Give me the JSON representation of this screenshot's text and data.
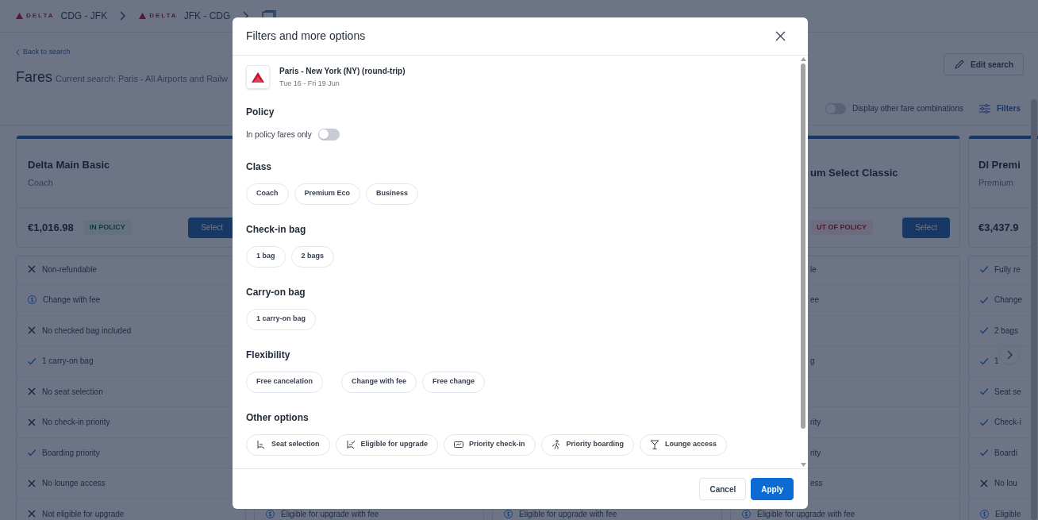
{
  "breadcrumbs": [
    {
      "kind": "flight",
      "airline": "DELTA",
      "route": "CDG - JFK"
    },
    {
      "kind": "flight",
      "airline": "DELTA",
      "route": "JFK - CDG"
    },
    {
      "kind": "page"
    }
  ],
  "back_link": "Back to search",
  "page_title": "Fares",
  "current_search": "Current search: Paris - All Airports and Railw",
  "edit_search_button": "Edit search",
  "fare_combinations_toggle": {
    "label": "Display other fare combinations",
    "on": false
  },
  "filters_link": "Filters",
  "fare_cards": [
    {
      "title": "Delta Main Basic",
      "cabin": "Coach",
      "price": "€1,016.98",
      "policy": {
        "kind": "in",
        "label": "IN POLICY"
      },
      "select_button": "Select",
      "features": [
        {
          "kind": "x",
          "label": "Non-refundable"
        },
        {
          "kind": "fee",
          "label": "Change with fee"
        },
        {
          "kind": "x",
          "label": "No checked bag included"
        },
        {
          "kind": "check",
          "label": "1 carry-on bag"
        },
        {
          "kind": "x",
          "label": "No seat selection"
        },
        {
          "kind": "x",
          "label": "No check-in priority"
        },
        {
          "kind": "check",
          "label": "Boarding priority"
        },
        {
          "kind": "x",
          "label": "No lounge access"
        },
        {
          "kind": "x",
          "label": "Not eligible for upgrade"
        }
      ]
    },
    {
      "features": [
        {
          "kind": "fee",
          "label": "Eligible for upgrade with fee"
        }
      ]
    },
    {
      "features": [
        {
          "kind": "fee",
          "label": "Eligible for upgrade with fee"
        }
      ]
    },
    {
      "title": "um Select Classic",
      "policy": {
        "kind": "out",
        "label": "UT OF POLICY"
      },
      "select_button": "Select",
      "features": [
        {
          "kind": "cut",
          "label": "le"
        },
        {
          "kind": "cut",
          "label": "ee"
        },
        {
          "kind": "blank"
        },
        {
          "kind": "cut",
          "label": "g"
        },
        {
          "kind": "blank"
        },
        {
          "kind": "cut",
          "label": "rity"
        },
        {
          "kind": "cut",
          "label": "rity"
        },
        {
          "kind": "cut",
          "label": "ess"
        },
        {
          "kind": "fee",
          "label": "Eligible for upgrade with fee"
        }
      ]
    },
    {
      "title": "Dl Premi",
      "cabin": "Premium",
      "price": "€3,437.9",
      "features": [
        {
          "kind": "check",
          "label": "Fully re"
        },
        {
          "kind": "check",
          "label": "Change"
        },
        {
          "kind": "check",
          "label": "2 bags"
        },
        {
          "kind": "check",
          "label": "1"
        },
        {
          "kind": "check",
          "label": "Seat se"
        },
        {
          "kind": "check",
          "label": "Check-i"
        },
        {
          "kind": "check",
          "label": "Boardi"
        },
        {
          "kind": "x",
          "label": "No lou"
        },
        {
          "kind": "fee",
          "label": "Eligible"
        }
      ]
    }
  ],
  "modal": {
    "title": "Filters and more options",
    "trip": {
      "route": "Paris - New York (NY) (round-trip)",
      "dates": "Tue 16 - Fri 19 Jun"
    },
    "policy": {
      "heading": "Policy",
      "toggle": {
        "label": "In policy fares only",
        "on": false
      }
    },
    "sections": [
      {
        "heading": "Class",
        "chips": [
          {
            "label": "Coach"
          },
          {
            "label": "Premium Eco"
          },
          {
            "label": "Business"
          }
        ]
      },
      {
        "heading": "Check-in bag",
        "chips": [
          {
            "label": "1 bag"
          },
          {
            "label": "2 bags"
          }
        ]
      },
      {
        "heading": "Carry-on bag",
        "chips": [
          {
            "label": "1 carry-on bag"
          }
        ]
      },
      {
        "heading": "Flexibility",
        "chips": [
          {
            "label": "Free cancelation"
          },
          {
            "label": "Change with fee"
          },
          {
            "label": "Free change"
          }
        ]
      },
      {
        "heading": "Other options",
        "chips": [
          {
            "label": "Seat selection",
            "kind": "seat"
          },
          {
            "label": "Eligible for upgrade",
            "kind": "upgrade"
          },
          {
            "label": "Priority check-in",
            "kind": "ticket"
          },
          {
            "label": "Priority boarding",
            "kind": "walker"
          },
          {
            "label": "Lounge access",
            "kind": "glass"
          }
        ]
      }
    ],
    "buttons": [
      {
        "kind": "secondary",
        "label": "Cancel"
      },
      {
        "kind": "primary",
        "label": "Apply"
      }
    ]
  }
}
